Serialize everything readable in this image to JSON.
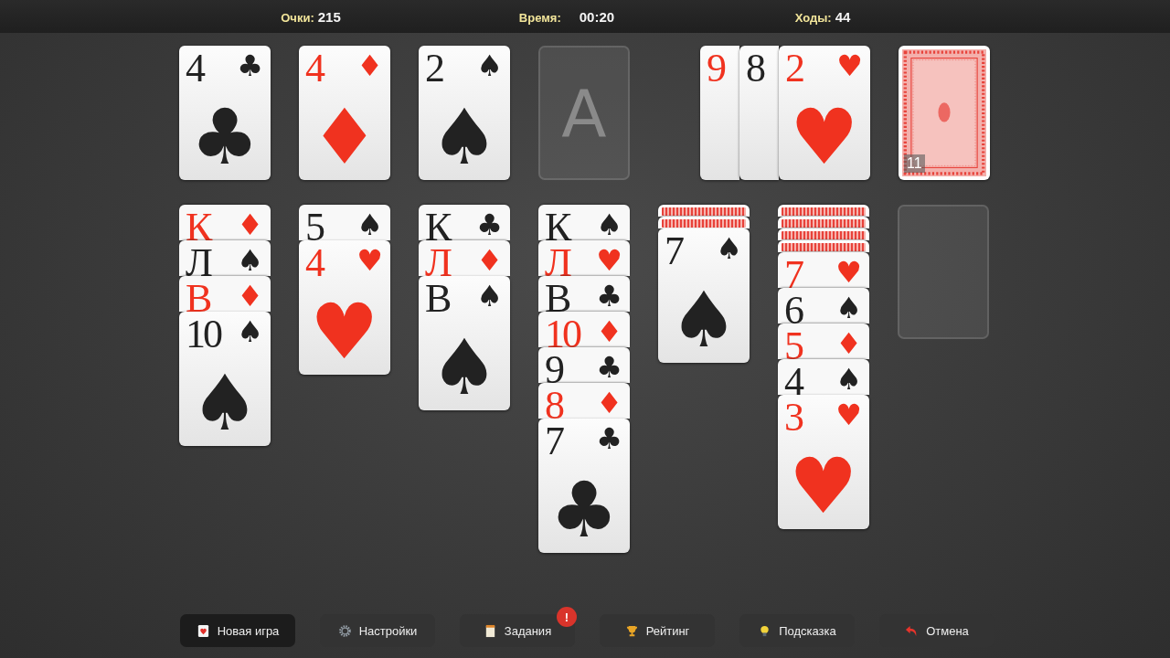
{
  "status_bar": [
    {
      "label": "Очки:",
      "value": "215"
    },
    {
      "label": "Время:",
      "value": "00:20"
    },
    {
      "label": "Ходы:",
      "value": "44"
    }
  ],
  "foundations": [
    {
      "kind": "card",
      "rank": "4",
      "suit": "♣",
      "color": "#222222"
    },
    {
      "kind": "card",
      "rank": "4",
      "suit": "♦",
      "color": "#f0321f"
    },
    {
      "kind": "card",
      "rank": "2",
      "suit": "♠",
      "color": "#222222"
    },
    {
      "kind": "empty",
      "letter": "A"
    }
  ],
  "waste": [
    {
      "rank": "9",
      "color": "#f0321f"
    },
    {
      "rank": "8",
      "color": "#222222"
    },
    {
      "rank": "2",
      "suit": "♥",
      "color": "#f0321f"
    }
  ],
  "stock": {
    "count": "11"
  },
  "tableau": [
    {
      "kind": "pile",
      "cards": [
        {
          "face_up": true,
          "rank": "К",
          "suit": "♦",
          "color": "#f0321f"
        },
        {
          "face_up": true,
          "rank": "Л",
          "suit": "♠",
          "color": "#222222"
        },
        {
          "face_up": true,
          "rank": "В",
          "suit": "♦",
          "color": "#f0321f"
        },
        {
          "face_up": true,
          "rank": "10",
          "suit": "♠",
          "color": "#222222"
        }
      ]
    },
    {
      "kind": "pile",
      "cards": [
        {
          "face_up": true,
          "rank": "5",
          "suit": "♠",
          "color": "#222222"
        },
        {
          "face_up": true,
          "rank": "4",
          "suit": "♥",
          "color": "#f0321f"
        }
      ]
    },
    {
      "kind": "pile",
      "cards": [
        {
          "face_up": true,
          "rank": "К",
          "suit": "♣",
          "color": "#222222"
        },
        {
          "face_up": true,
          "rank": "Л",
          "suit": "♦",
          "color": "#f0321f"
        },
        {
          "face_up": true,
          "rank": "В",
          "suit": "♠",
          "color": "#222222"
        }
      ]
    },
    {
      "kind": "pile",
      "cards": [
        {
          "face_up": true,
          "rank": "К",
          "suit": "♠",
          "color": "#222222"
        },
        {
          "face_up": true,
          "rank": "Л",
          "suit": "♥",
          "color": "#f0321f"
        },
        {
          "face_up": true,
          "rank": "В",
          "suit": "♣",
          "color": "#222222"
        },
        {
          "face_up": true,
          "rank": "10",
          "suit": "♦",
          "color": "#f0321f"
        },
        {
          "face_up": true,
          "rank": "9",
          "suit": "♣",
          "color": "#222222"
        },
        {
          "face_up": true,
          "rank": "8",
          "suit": "♦",
          "color": "#f0321f"
        },
        {
          "face_up": true,
          "rank": "7",
          "suit": "♣",
          "color": "#222222"
        }
      ]
    },
    {
      "kind": "pile",
      "cards": [
        {
          "face_up": false
        },
        {
          "face_up": false
        },
        {
          "face_up": true,
          "rank": "7",
          "suit": "♠",
          "color": "#222222"
        }
      ]
    },
    {
      "kind": "pile",
      "cards": [
        {
          "face_up": false
        },
        {
          "face_up": false
        },
        {
          "face_up": false
        },
        {
          "face_up": false
        },
        {
          "face_up": true,
          "rank": "7",
          "suit": "♥",
          "color": "#f0321f"
        },
        {
          "face_up": true,
          "rank": "6",
          "suit": "♠",
          "color": "#222222"
        },
        {
          "face_up": true,
          "rank": "5",
          "suit": "♦",
          "color": "#f0321f"
        },
        {
          "face_up": true,
          "rank": "4",
          "suit": "♠",
          "color": "#222222"
        },
        {
          "face_up": true,
          "rank": "3",
          "suit": "♥",
          "color": "#f0321f"
        }
      ]
    },
    {
      "kind": "empty"
    }
  ],
  "toolbar": [
    {
      "label": "Новая игра",
      "selected": true
    },
    {
      "label": "Настройки",
      "selected": false
    },
    {
      "label": "Задания",
      "selected": false,
      "badge": "!"
    },
    {
      "label": "Рейтинг",
      "selected": false
    },
    {
      "label": "Подсказка",
      "selected": false
    },
    {
      "label": "Отмена",
      "selected": false
    }
  ]
}
